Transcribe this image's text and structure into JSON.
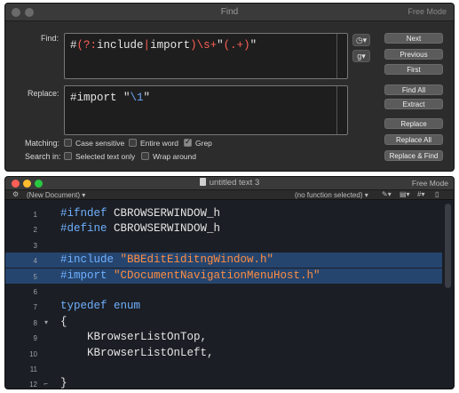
{
  "find": {
    "title": "Find",
    "mode": "Free Mode",
    "find_label": "Find:",
    "replace_label": "Replace:",
    "find_value_parts": [
      "#",
      "(?:",
      "include",
      "|",
      "import",
      ")",
      "\\s",
      "+",
      "\"",
      "(.+)",
      "\""
    ],
    "replace_value_parts": [
      "#import \"",
      "\\1",
      "\""
    ],
    "history_icon": "clock-icon",
    "grep_menu_label": "g",
    "buttons": {
      "next": "Next",
      "previous": "Previous",
      "first": "First",
      "find_all": "Find All",
      "extract": "Extract",
      "replace": "Replace",
      "replace_all": "Replace All",
      "replace_find": "Replace & Find"
    },
    "matching_label": "Matching:",
    "search_in_label": "Search in:",
    "options": {
      "case_sensitive": {
        "label": "Case sensitive",
        "checked": false
      },
      "entire_word": {
        "label": "Entire word",
        "checked": false
      },
      "grep": {
        "label": "Grep",
        "checked": true
      },
      "selected_text_only": {
        "label": "Selected text only",
        "checked": false
      },
      "wrap_around": {
        "label": "Wrap around",
        "checked": false
      }
    },
    "colors": {
      "background": "#2c2c2c",
      "button": "#5b5b5b",
      "regex_red": "#ff5f56",
      "escape_blue": "#6fa8ff"
    }
  },
  "editor": {
    "title": "untitled text 3",
    "mode": "Free Mode",
    "doc_menu": "(New Document)",
    "function_menu": "(no function selected)",
    "lines": [
      {
        "num": "1",
        "fold": "",
        "parts": [
          [
            "kw",
            "#ifndef "
          ],
          [
            "plain",
            "CBROWSERWINDOW_h"
          ]
        ],
        "hl": false
      },
      {
        "num": "2",
        "fold": "",
        "parts": [
          [
            "kw",
            "#define "
          ],
          [
            "plain",
            "CBROWSERWINDOW_h"
          ]
        ],
        "hl": false
      },
      {
        "num": "3",
        "fold": "",
        "parts": [],
        "hl": false
      },
      {
        "num": "4",
        "fold": "",
        "parts": [
          [
            "kw",
            "#include "
          ],
          [
            "str",
            "\"BBEditEiditngWindow.h\""
          ]
        ],
        "hl": true
      },
      {
        "num": "5",
        "fold": "",
        "parts": [
          [
            "kw",
            "#import "
          ],
          [
            "str",
            "\"CDocumentNavigationMenuHost.h\""
          ]
        ],
        "hl": true
      },
      {
        "num": "6",
        "fold": "",
        "parts": [],
        "hl": false
      },
      {
        "num": "7",
        "fold": "",
        "parts": [
          [
            "kw",
            "typedef enum"
          ]
        ],
        "hl": false
      },
      {
        "num": "8",
        "fold": "▾",
        "parts": [
          [
            "plain",
            "{"
          ]
        ],
        "hl": false
      },
      {
        "num": "9",
        "fold": "",
        "parts": [
          [
            "plain",
            "    KBrowserListOnTop,"
          ]
        ],
        "hl": false
      },
      {
        "num": "10",
        "fold": "",
        "parts": [
          [
            "plain",
            "    KBrowserListOnLeft,"
          ]
        ],
        "hl": false
      },
      {
        "num": "11",
        "fold": "",
        "parts": [],
        "hl": false
      },
      {
        "num": "12",
        "fold": "⌐",
        "parts": [
          [
            "plain",
            "}"
          ]
        ],
        "hl": false
      }
    ],
    "colors": {
      "background": "#1b1e24",
      "selection": "#25456e",
      "keyword": "#6fb0ff",
      "string": "#ff8d42",
      "red": "#ff5f57",
      "yellow": "#febc2e",
      "green": "#28c840"
    }
  }
}
